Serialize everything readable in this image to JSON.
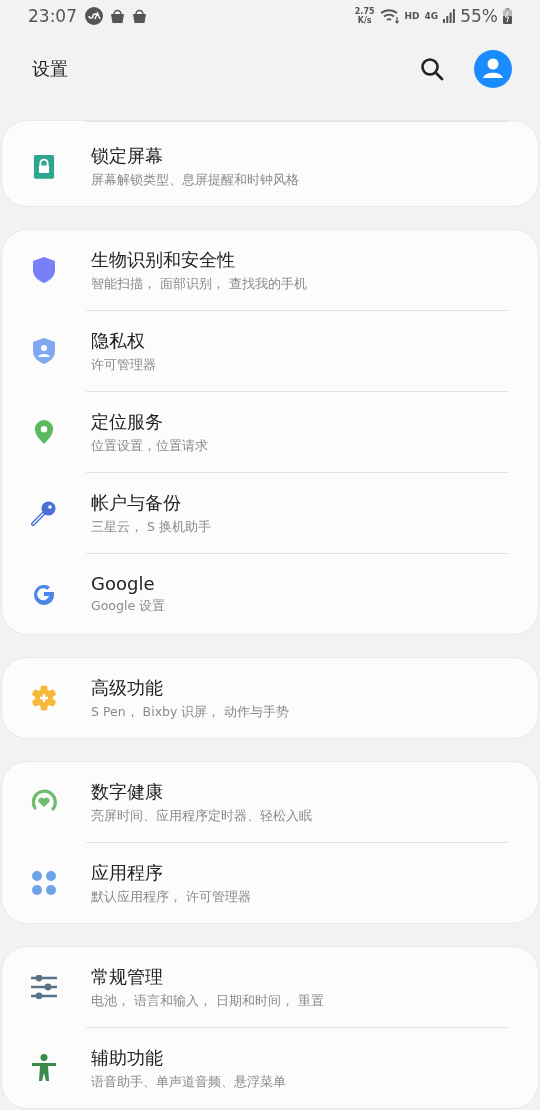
{
  "status_bar": {
    "time": "23:07",
    "speed_value": "2.75",
    "speed_unit": "K/s",
    "hd": "HD",
    "network": "4G",
    "battery": "55%"
  },
  "header": {
    "title": "设置"
  },
  "groups": [
    {
      "items": [
        {
          "kind": "lock",
          "title": "锁定屏幕",
          "subtitle": "屏幕解锁类型、息屏提醒和时钟风格"
        }
      ]
    },
    {
      "items": [
        {
          "kind": "shield",
          "title": "生物识别和安全性",
          "subtitle": "智能扫描， 面部识别， 查找我的手机"
        },
        {
          "kind": "privacy",
          "title": "隐私权",
          "subtitle": "许可管理器"
        },
        {
          "kind": "location",
          "title": "定位服务",
          "subtitle": "位置设置，位置请求"
        },
        {
          "kind": "key",
          "title": "帐户与备份",
          "subtitle": "三星云， S 换机助手"
        },
        {
          "kind": "google",
          "title": "Google",
          "subtitle": "Google 设置"
        }
      ]
    },
    {
      "items": [
        {
          "kind": "advanced",
          "title": "高级功能",
          "subtitle": "S Pen， Bixby 识屏， 动作与手势"
        }
      ]
    },
    {
      "items": [
        {
          "kind": "wellbeing",
          "title": "数字健康",
          "subtitle": "亮屏时间、应用程序定时器、轻松入眠"
        },
        {
          "kind": "apps",
          "title": "应用程序",
          "subtitle": "默认应用程序， 许可管理器"
        }
      ]
    },
    {
      "items": [
        {
          "kind": "general",
          "title": "常规管理",
          "subtitle": "电池， 语言和输入， 日期和时间， 重置"
        },
        {
          "kind": "accessibility",
          "title": "辅助功能",
          "subtitle": "语音助手、单声道音频、悬浮菜单"
        }
      ]
    }
  ]
}
